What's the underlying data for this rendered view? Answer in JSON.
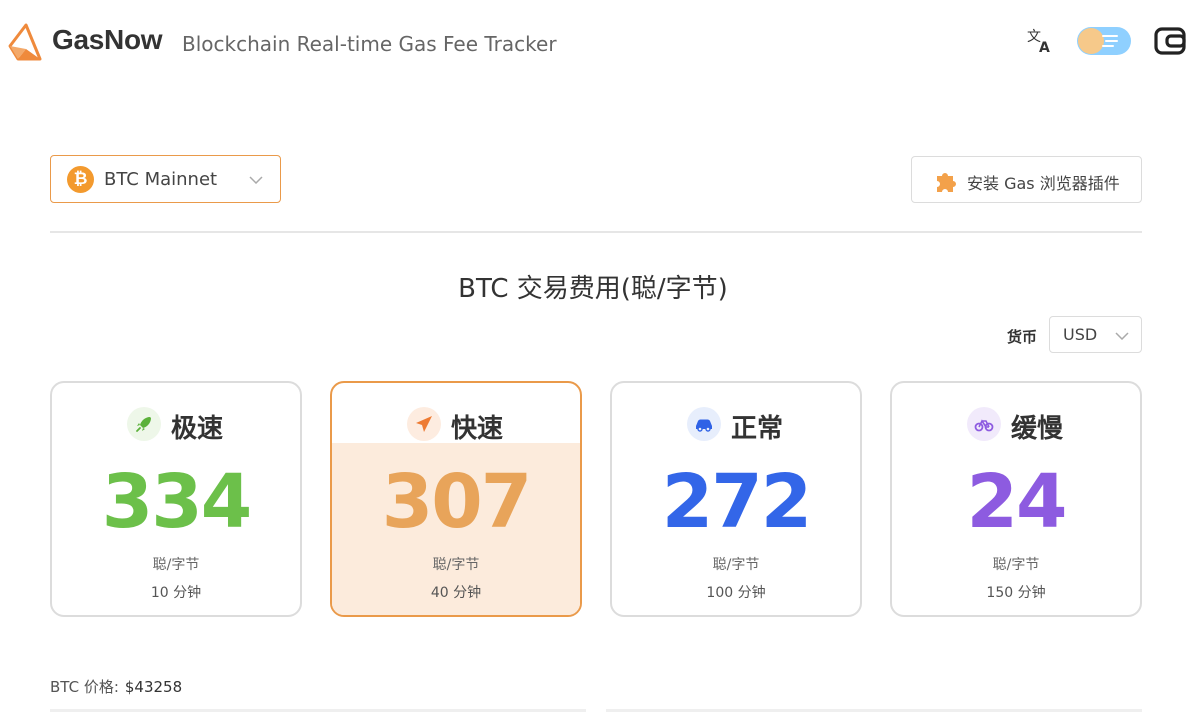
{
  "header": {
    "brand": "GasNow",
    "tagline": "Blockchain Real-time Gas Fee Tracker",
    "icons": [
      "gasnow-logo-icon",
      "translate-icon",
      "theme-toggle",
      "wallet-icon"
    ]
  },
  "controls": {
    "network": "BTC Mainnet",
    "extension_button": "安装 Gas 浏览器插件",
    "currency_label": "货币",
    "currency_value": "USD"
  },
  "section_title": "BTC 交易费用(聪/字节)",
  "tiers": [
    {
      "name": "极速",
      "value": "334",
      "unit": "聪/字节",
      "time": "10 分钟",
      "color": "#6cc04a",
      "icon_bg": "#eef7e9",
      "icon": "rocket-icon"
    },
    {
      "name": "快速",
      "value": "307",
      "unit": "聪/字节",
      "time": "40 分钟",
      "color": "#e8a45a",
      "icon_bg": "#fdece0",
      "icon": "plane-icon",
      "selected": true
    },
    {
      "name": "正常",
      "value": "272",
      "unit": "聪/字节",
      "time": "100 分钟",
      "color": "#3366e8",
      "icon_bg": "#e7eefc",
      "icon": "car-icon"
    },
    {
      "name": "缓慢",
      "value": "24",
      "unit": "聪/字节",
      "time": "150 分钟",
      "color": "#8d5be0",
      "icon_bg": "#f1eafb",
      "icon": "bike-icon"
    }
  ],
  "price": {
    "label": "BTC 价格:",
    "value": "$43258"
  },
  "colors": {
    "accent": "#ea9a4a",
    "selected_bg": "#fcebdc"
  }
}
